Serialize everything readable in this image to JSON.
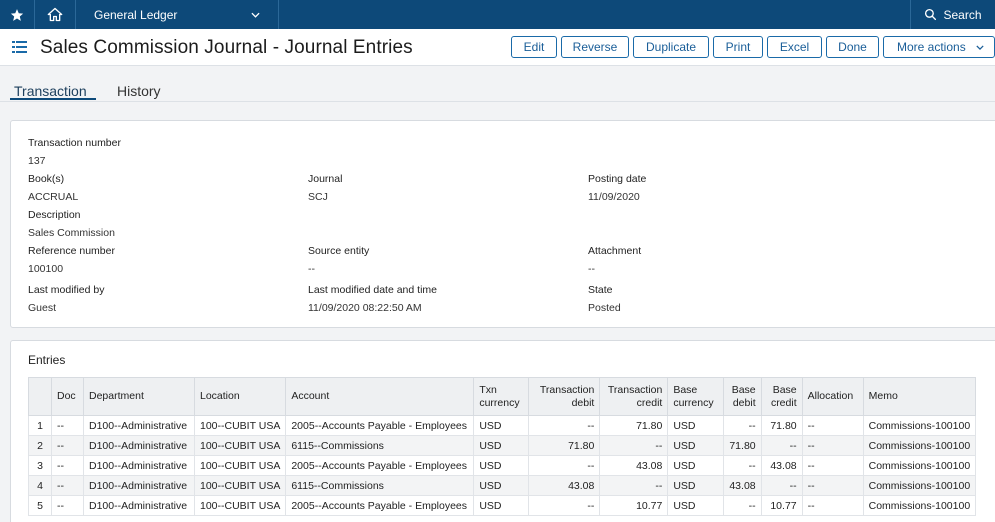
{
  "topbar": {
    "module_name": "General Ledger",
    "search_label": "Search"
  },
  "header": {
    "title": "Sales Commission Journal - Journal Entries",
    "actions": [
      "Edit",
      "Reverse",
      "Duplicate",
      "Print",
      "Excel",
      "Done",
      "More actions"
    ]
  },
  "tabs": [
    "Transaction",
    "History"
  ],
  "transaction": {
    "transaction_number": {
      "label": "Transaction number",
      "value": "137"
    },
    "books": {
      "label": "Book(s)",
      "value": "ACCRUAL"
    },
    "journal": {
      "label": "Journal",
      "value": "SCJ"
    },
    "posting_date": {
      "label": "Posting date",
      "value": "11/09/2020"
    },
    "description": {
      "label": "Description",
      "value": "Sales Commission"
    },
    "reference_number": {
      "label": "Reference number",
      "value": "100100"
    },
    "source_entity": {
      "label": "Source entity",
      "value": "--"
    },
    "attachment": {
      "label": "Attachment",
      "value": "--"
    },
    "last_modified_by": {
      "label": "Last modified by",
      "value": "Guest"
    },
    "last_modified_datetime": {
      "label": "Last modified date and time",
      "value": "11/09/2020 08:22:50 AM"
    },
    "state": {
      "label": "State",
      "value": "Posted"
    }
  },
  "entries": {
    "title": "Entries",
    "columns": [
      "",
      "Doc",
      "Department",
      "Location",
      "Account",
      "Txn currency",
      "Transaction debit",
      "Transaction credit",
      "Base currency",
      "Base debit",
      "Base credit",
      "Allocation",
      "Memo"
    ],
    "rows": [
      [
        "1",
        "--",
        "D100--Administrative",
        "100--CUBIT USA",
        "2005--Accounts Payable - Employees",
        "USD",
        "--",
        "71.80",
        "USD",
        "--",
        "71.80",
        "--",
        "Commissions-100100"
      ],
      [
        "2",
        "--",
        "D100--Administrative",
        "100--CUBIT USA",
        "6115--Commissions",
        "USD",
        "71.80",
        "--",
        "USD",
        "71.80",
        "--",
        "--",
        "Commissions-100100"
      ],
      [
        "3",
        "--",
        "D100--Administrative",
        "100--CUBIT USA",
        "2005--Accounts Payable - Employees",
        "USD",
        "--",
        "43.08",
        "USD",
        "--",
        "43.08",
        "--",
        "Commissions-100100"
      ],
      [
        "4",
        "--",
        "D100--Administrative",
        "100--CUBIT USA",
        "6115--Commissions",
        "USD",
        "43.08",
        "--",
        "USD",
        "43.08",
        "--",
        "--",
        "Commissions-100100"
      ],
      [
        "5",
        "--",
        "D100--Administrative",
        "100--CUBIT USA",
        "2005--Accounts Payable - Employees",
        "USD",
        "--",
        "10.77",
        "USD",
        "--",
        "10.77",
        "--",
        "Commissions-100100"
      ]
    ]
  },
  "colors": {
    "nav_bg": "#0d4979",
    "accent": "#1a6aa8"
  }
}
